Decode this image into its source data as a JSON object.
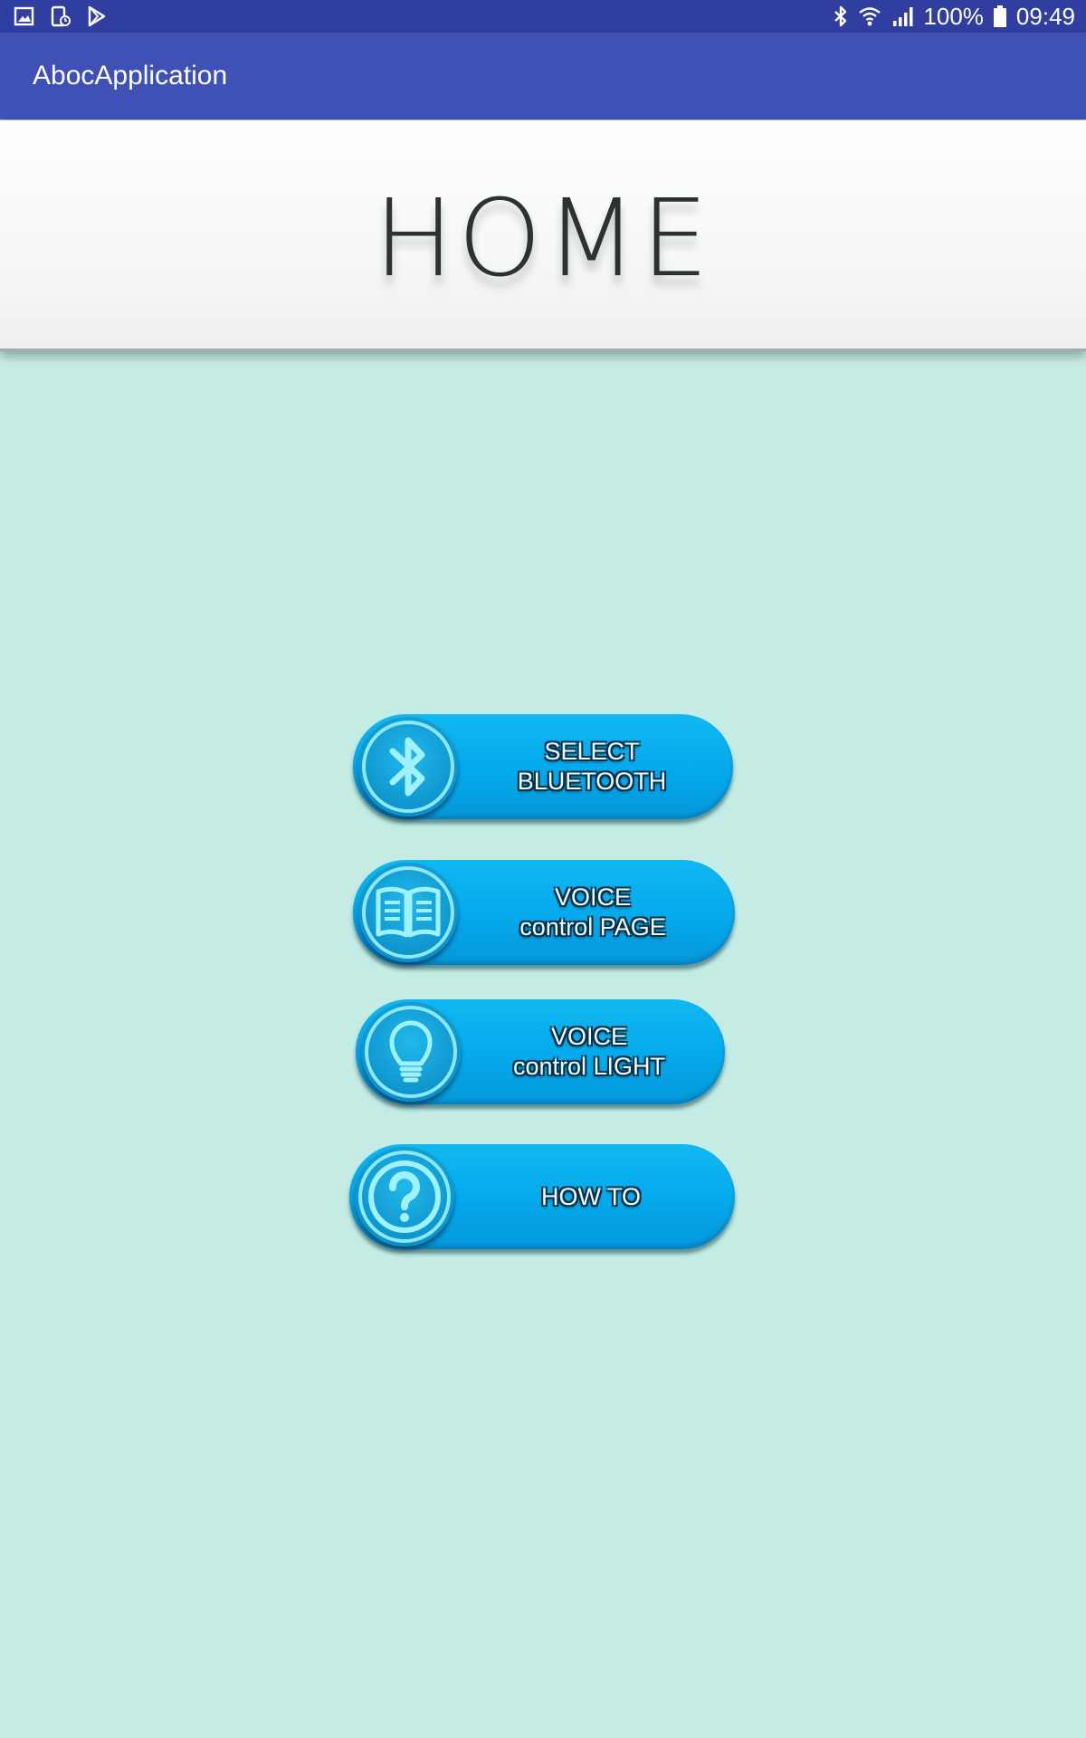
{
  "status_bar": {
    "notification_icons": [
      "image-icon",
      "device-sync-icon",
      "play-store-icon"
    ],
    "system_icons": [
      "bluetooth-icon",
      "wifi-icon",
      "signal-icon",
      "battery-icon"
    ],
    "battery": "100%",
    "time": "09:49"
  },
  "app_bar": {
    "title": "AbocApplication"
  },
  "banner": {
    "title": "HOME"
  },
  "menu": {
    "bluetooth": {
      "line1": "SELECT",
      "line2": "BLUETOOTH",
      "icon": "bluetooth-icon"
    },
    "voice_page": {
      "line1": "VOICE",
      "line2": "control PAGE",
      "icon": "book-icon"
    },
    "voice_light": {
      "line1": "VOICE",
      "line2": "control LIGHT",
      "icon": "lightbulb-icon"
    },
    "how_to": {
      "line1": "HOW TO",
      "icon": "question-icon"
    }
  },
  "colors": {
    "status_bar": "#303f9f",
    "app_bar": "#3f51b5",
    "background": "#c4ece5",
    "button": "#04a9ec"
  }
}
